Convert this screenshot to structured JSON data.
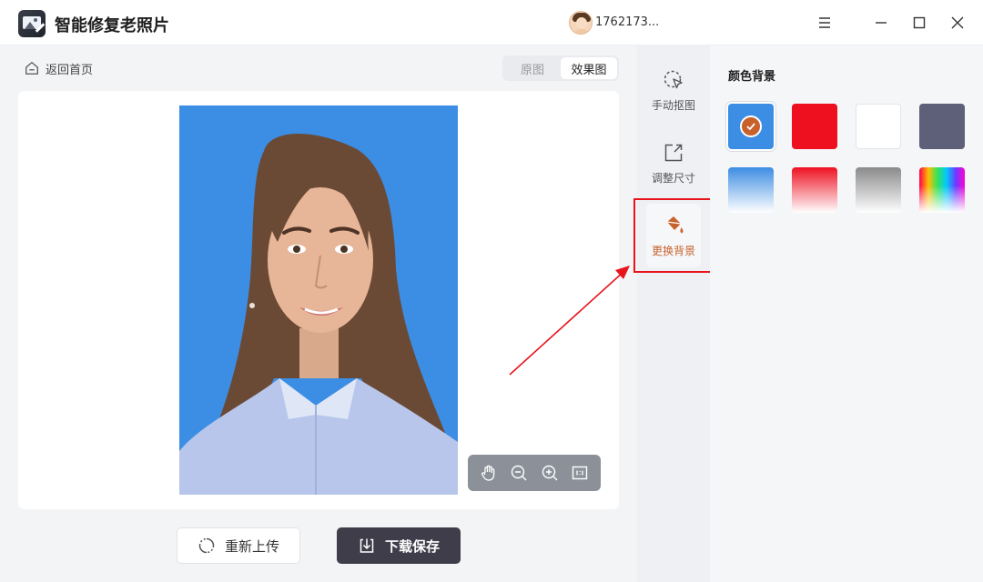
{
  "app": {
    "title": "智能修复老照片",
    "icon": "app-photo-icon"
  },
  "user": {
    "name": "1762173...",
    "avatar": "user-avatar-icon"
  },
  "window_controls": [
    "menu-icon",
    "minimize-icon",
    "maximize-icon",
    "close-icon"
  ],
  "nav": {
    "back_label": "返回首页"
  },
  "view_toggle": {
    "options": [
      "原图",
      "效果图"
    ],
    "selected": "效果图"
  },
  "photo": {
    "background_color": "#3c8ee4"
  },
  "zoom_tools": [
    "hand-icon",
    "zoom-out-icon",
    "zoom-in-icon",
    "fit-icon"
  ],
  "actions": {
    "reupload_label": "重新上传",
    "download_label": "下载保存"
  },
  "tools": [
    {
      "label": "手动抠图",
      "icon": "manual-cutout-icon",
      "active": false
    },
    {
      "label": "调整尺寸",
      "icon": "resize-icon",
      "active": false
    },
    {
      "label": "更换背景",
      "icon": "paint-bucket-icon",
      "active": true
    }
  ],
  "background_panel": {
    "title": "颜色背景",
    "selected": 0,
    "swatches": [
      {
        "name": "blue",
        "fill": "#3c8ee4"
      },
      {
        "name": "red",
        "fill": "#ee0f1f"
      },
      {
        "name": "white",
        "fill": "#ffffff"
      },
      {
        "name": "gray",
        "fill": "#5e5f78"
      },
      {
        "name": "blue-gradient",
        "fill": "linear-gradient(#3d8de3,#ffffff)"
      },
      {
        "name": "red-gradient",
        "fill": "linear-gradient(#ee1122,#ffffff)"
      },
      {
        "name": "gray-gradient",
        "fill": "linear-gradient(#8a8a8a,#ffffff)"
      },
      {
        "name": "rainbow",
        "fill": "linear-gradient(to right,#ff004c,#ffbf00,#35e35b,#00c8ff,#6a3cff,#ff00d4),linear-gradient(transparent,#ffffff)"
      }
    ]
  },
  "colors": {
    "accent": "#c7622c",
    "annotation": "#e8141c",
    "primary_button": "#3f3d4a"
  }
}
